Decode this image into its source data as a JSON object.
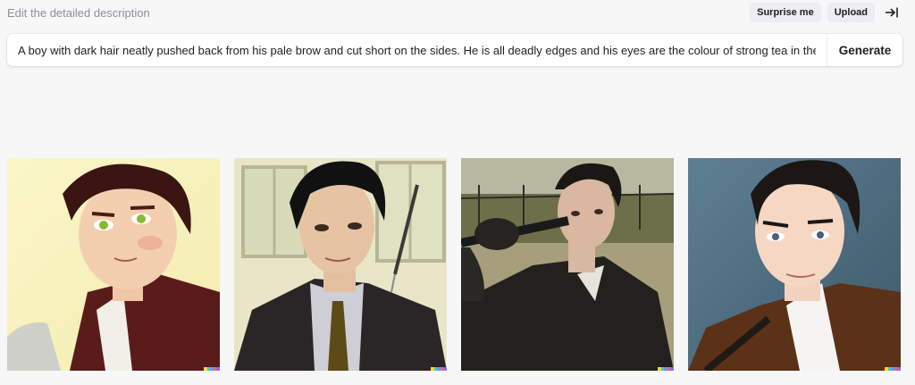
{
  "header": {
    "hint": "Edit the detailed description",
    "surprise_label": "Surprise me",
    "upload_label": "Upload",
    "collapse_icon": "arrow-right-to-bar-icon"
  },
  "prompt": {
    "value": "A boy with dark hair neatly pushed back from his pale brow and cut short on the sides. He is all deadly edges and his eyes are the colour of strong tea in the s",
    "generate_label": "Generate"
  },
  "images": [
    {
      "style": "illustrated portrait, pale yellow background, green eyes, dark red coat"
    },
    {
      "style": "painted portrait, window background, black coat, dark tie"
    },
    {
      "style": "photographic portrait, outdoor park, black coat, gloved hand raised"
    },
    {
      "style": "painted portrait, blue-grey background, brown coat, white shirt"
    }
  ],
  "colors": {
    "background": "#f7f7f8",
    "accent_signature": [
      "#f9d342",
      "#4ec9b0",
      "#5b9bf8",
      "#e86b6b",
      "#8f6bf0"
    ]
  }
}
